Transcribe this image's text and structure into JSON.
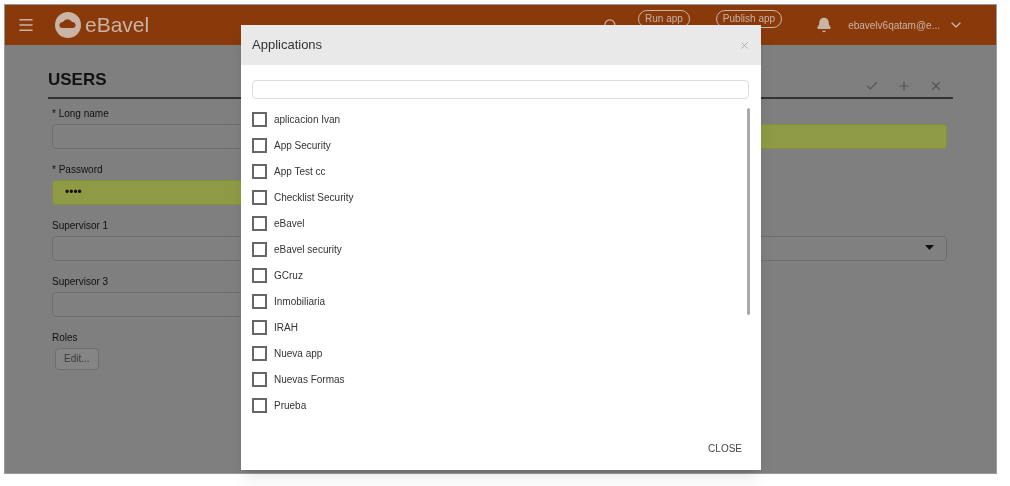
{
  "header": {
    "app_name": "eBavel",
    "buttons": [
      "Run app",
      "Publish app"
    ],
    "user": "ebavelv6qatam@e..."
  },
  "page": {
    "title": "USERS"
  },
  "left_fields": [
    {
      "label": "* Long name",
      "kind": "text",
      "highlighted": false
    },
    {
      "label": "* Password",
      "kind": "text",
      "value": "••••",
      "highlighted": true
    },
    {
      "label": "Supervisor 1",
      "kind": "text",
      "highlighted": false
    },
    {
      "label": "Supervisor 3",
      "kind": "text",
      "highlighted": false
    },
    {
      "label": "Roles",
      "kind": "button",
      "value": "Edit..."
    }
  ],
  "right_fields": [
    {
      "kind": "text",
      "highlighted": true
    },
    {
      "kind": "none"
    },
    {
      "kind": "select",
      "highlighted": false
    }
  ],
  "dialog": {
    "title": "Applications",
    "items": [
      {
        "label": "aplicacion Ivan",
        "checked": false
      },
      {
        "label": "App Security",
        "checked": false
      },
      {
        "label": "App Test cc",
        "checked": false
      },
      {
        "label": "Checklist Security",
        "checked": false
      },
      {
        "label": "eBavel",
        "checked": false
      },
      {
        "label": "eBavel security",
        "checked": false
      },
      {
        "label": "GCruz",
        "checked": false
      },
      {
        "label": "Inmobiliaria",
        "checked": false
      },
      {
        "label": "IRAH",
        "checked": false
      },
      {
        "label": "Nueva app",
        "checked": false
      },
      {
        "label": "Nuevas Formas",
        "checked": false
      },
      {
        "label": "Prueba",
        "checked": false
      }
    ],
    "close_button": "CLOSE"
  }
}
